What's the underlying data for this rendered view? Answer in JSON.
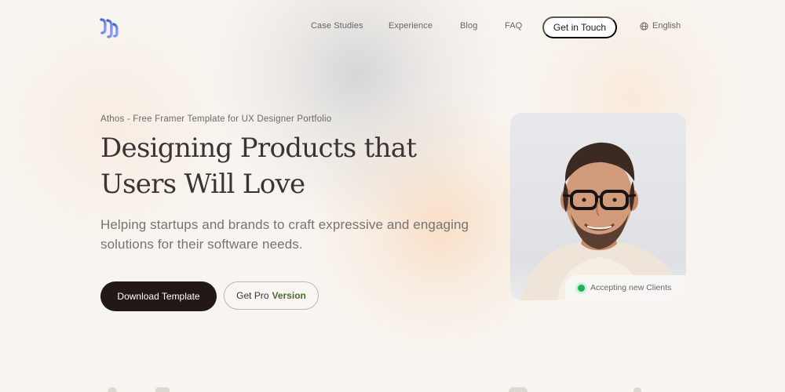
{
  "header": {
    "logo_icon": "brand-logo-icon",
    "nav": [
      {
        "label": "Case Studies"
      },
      {
        "label": "Experience"
      },
      {
        "label": "Blog"
      },
      {
        "label": "FAQ"
      }
    ],
    "cta_label": "Get in Touch",
    "language_icon": "globe-icon",
    "language_label": "English"
  },
  "hero": {
    "eyebrow": "Athos - Free Framer Template for UX Designer Portfolio",
    "headline_line1": "Designing Products that",
    "headline_line2": "Users Will Love",
    "description_line1": "Helping startups and brands to craft expressive and engaging",
    "description_line2": "solutions for their software needs.",
    "primary_button": "Download Template",
    "secondary_button_prefix": "Get Pro",
    "secondary_button_accent": "Version"
  },
  "profile": {
    "status_label": "Accepting new Clients",
    "status_color": "#16b35a"
  },
  "colors": {
    "background": "#f8f5f1",
    "primary_button": "#221917",
    "accent_green": "#4c6b28",
    "logo_gradient_start": "#465dcf",
    "logo_gradient_end": "#8ea4ff"
  }
}
